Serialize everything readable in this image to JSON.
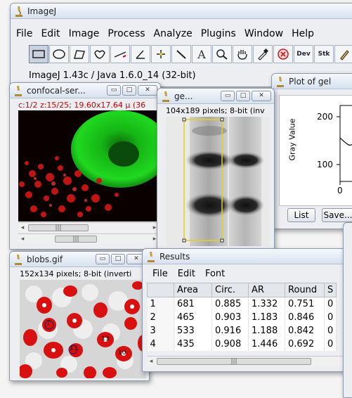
{
  "main": {
    "title": "ImageJ",
    "menu": [
      "File",
      "Edit",
      "Image",
      "Process",
      "Analyze",
      "Plugins",
      "Window",
      "Help"
    ],
    "toolbar_icons": [
      "rectangle-tool-icon",
      "oval-tool-icon",
      "polygon-tool-icon",
      "freehand-tool-icon",
      "straight-line-tool-icon",
      "angle-tool-icon",
      "point-tool-icon",
      "wand-tool-icon",
      "text-tool-icon",
      "magnifying-glass-icon",
      "hand-tool-icon",
      "color-picker-icon",
      "record-stop-icon",
      "dev-menu-icon",
      "stk-menu-icon",
      "pencil-tool-icon"
    ],
    "dev_label": "Dev",
    "stk_label": "Stk",
    "text_tool": "A",
    "status": "ImageJ 1.43c / Java 1.6.0_14 (32-bit)"
  },
  "confocal": {
    "title": "confocal-ser...",
    "info": "c:1/2 z:15/25; 19.60x17.64 μ (36",
    "colors": {
      "info_text": "#cc0000",
      "green": "#18c818",
      "red": "#d01818"
    }
  },
  "gel": {
    "title": "ge...",
    "info": "104x189 pixels; 8-bit (inv"
  },
  "plot": {
    "title": "Plot of gel",
    "ylabel": "Gray Value",
    "ytick_top": "200",
    "ytick_mid": "100",
    "xtick_zero": "0",
    "list_button": "List",
    "save_button": "Save..."
  },
  "blobs": {
    "title": "blobs.gif",
    "info": "152x134 pixels; 8-bit (inverti",
    "labels": [
      "7",
      "11",
      "13",
      "10"
    ]
  },
  "results": {
    "title": "Results",
    "menu": [
      "File",
      "Edit",
      "Font"
    ],
    "columns": [
      "",
      "Area",
      "Circ.",
      "AR",
      "Round",
      "S"
    ],
    "rows": [
      [
        "1",
        "681",
        "0.885",
        "1.332",
        "0.751",
        "0"
      ],
      [
        "2",
        "465",
        "0.903",
        "1.183",
        "0.846",
        "0"
      ],
      [
        "3",
        "533",
        "0.916",
        "1.188",
        "0.842",
        "0"
      ],
      [
        "4",
        "435",
        "0.908",
        "1.446",
        "0.692",
        "0"
      ]
    ]
  },
  "common": {
    "minimize_glyph": "▭",
    "maximize_glyph": "□",
    "close_glyph": "✕",
    "scroll_left": "◂",
    "scroll_right": "▸",
    "thumb_grip": "|||"
  }
}
